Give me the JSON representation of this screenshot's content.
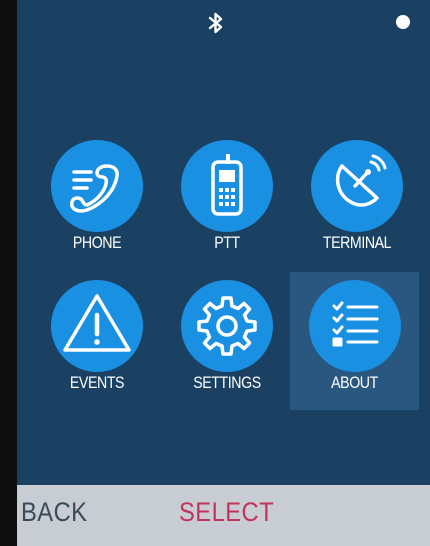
{
  "status_bar": {
    "bluetooth_icon": "bluetooth-icon",
    "indicator_icon": "status-dot-icon"
  },
  "menu": {
    "items": [
      {
        "label": "PHONE",
        "icon": "phone-icon",
        "selected": false
      },
      {
        "label": "PTT",
        "icon": "radio-handset-icon",
        "selected": false
      },
      {
        "label": "TERMINAL",
        "icon": "satellite-dish-icon",
        "selected": false
      },
      {
        "label": "EVENTS",
        "icon": "warning-triangle-icon",
        "selected": false
      },
      {
        "label": "SETTINGS",
        "icon": "gear-icon",
        "selected": false
      },
      {
        "label": "ABOUT",
        "icon": "checklist-icon",
        "selected": true
      }
    ]
  },
  "softkeys": {
    "left": "BACK",
    "center": "SELECT"
  },
  "colors": {
    "background": "#1b4162",
    "icon_circle": "#1a90e2",
    "selected_tile": "#29577f",
    "softkey_bar": "#c7cdd2",
    "back_text": "#3b4a58",
    "select_text": "#c4335a"
  }
}
